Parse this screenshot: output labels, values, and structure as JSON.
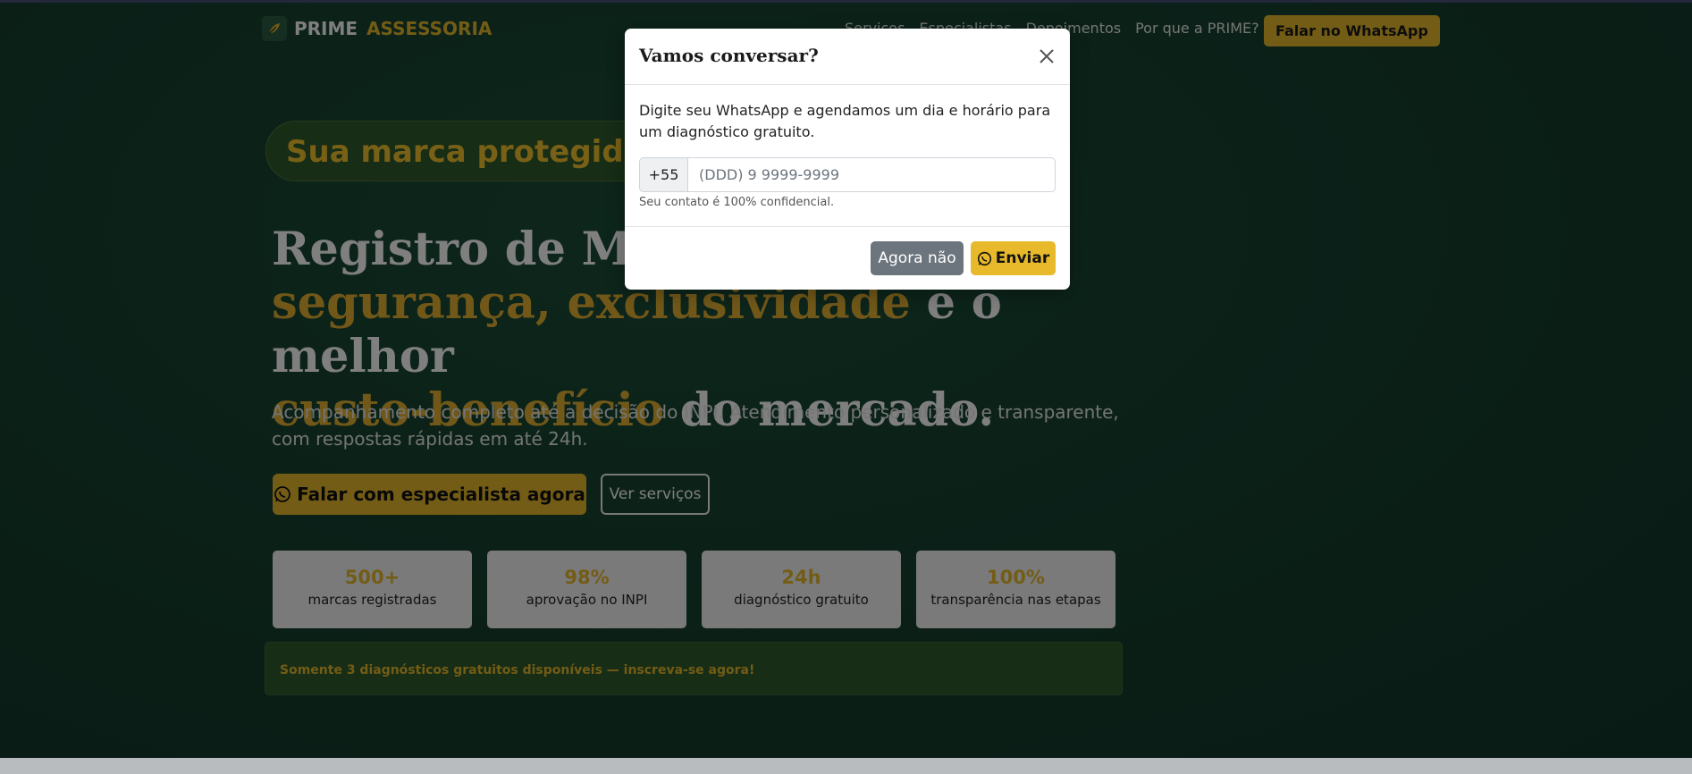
{
  "nav": {
    "brand_prime": "PRIME",
    "brand_assessoria": "ASSESSORIA",
    "links": [
      "Serviços",
      "Especialistas",
      "Depoimentos",
      "Por que a PRIME?"
    ],
    "cta": "Falar no WhatsApp"
  },
  "hero": {
    "pill": "Sua marca protegida! Se",
    "headline_line1": "Registro de Marca",
    "headline_gold1": "segurança, exclusividade",
    "headline_line2_rest": " e o melhor",
    "headline_gold2": "custo-benefício",
    "headline_line3_rest": " do mercado.",
    "subtitle": "Acompanhamento completo até a decisão do INPI. Atendimento personalizado e transparente, com respostas rápidas em até 24h.",
    "primary_button": "Falar com especialista agora",
    "secondary_button": "Ver serviços"
  },
  "stats": [
    {
      "value": "500+",
      "label": "marcas registradas"
    },
    {
      "value": "98%",
      "label": "aprovação no INPI"
    },
    {
      "value": "24h",
      "label": "diagnóstico gratuito"
    },
    {
      "value": "100%",
      "label": "transparência nas etapas"
    }
  ],
  "notice": "Somente 3 diagnósticos gratuitos disponíveis — inscreva-se agora!",
  "modal": {
    "title": "Vamos conversar?",
    "text": "Digite seu WhatsApp e agendamos um dia e horário para um diagnóstico gratuito.",
    "prefix": "+55",
    "placeholder": "(DDD) 9 9999-9999",
    "help": "Seu contato é 100% confidencial.",
    "cancel": "Agora não",
    "send": "Enviar"
  },
  "colors": {
    "accent": "#e7b92b",
    "background": "#163f2e",
    "secondary_button": "#6c757d"
  }
}
